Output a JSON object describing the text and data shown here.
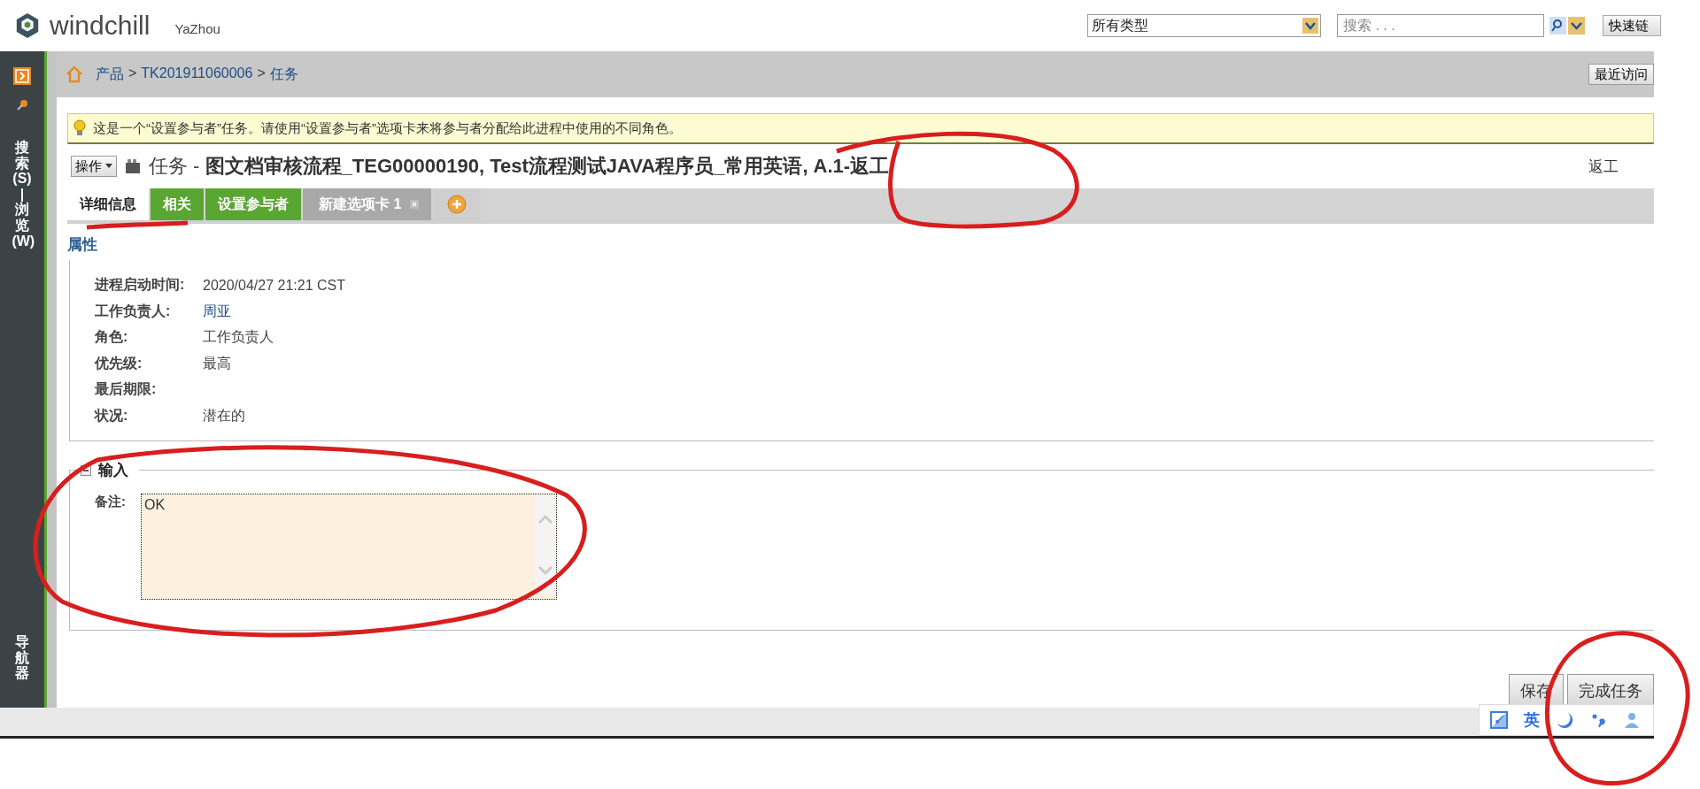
{
  "header": {
    "logo": "windchill",
    "user": "YaZhou",
    "type_select": {
      "value": "所有类型"
    },
    "search": {
      "placeholder": "搜索 . . ."
    },
    "quick_links": "快速链"
  },
  "sidebar": {
    "tabs": [
      {
        "label": "搜索(S) | 浏览(W)"
      },
      {
        "label": "导航器"
      }
    ]
  },
  "breadcrumb": {
    "separator": ">",
    "items": [
      "产品",
      "TK201911060006",
      "任务"
    ],
    "recent": "最近访问"
  },
  "tip": "这是一个“设置参与者”任务。请使用“设置参与者”选项卡来将参与者分配给此进程中使用的不同角色。",
  "title": {
    "actions": "操作",
    "text": "任务 - **图文档审核流程_TEG00000190, Test流程测试JAVA程序员_常用英语, A.1-返工**",
    "state": "返工"
  },
  "tabs": [
    {
      "label": "详细信息",
      "kind": "plain",
      "selected": true
    },
    {
      "label": "相关",
      "kind": "green",
      "selected": false
    },
    {
      "label": "设置参与者",
      "kind": "green",
      "selected": false
    },
    {
      "label": "新建选项卡 1",
      "kind": "closable",
      "selected": false
    },
    {
      "kind": "add",
      "selected": false
    }
  ],
  "attributes": {
    "heading": "属性",
    "rows": [
      {
        "label": "进程启动时间:",
        "value": "2020/04/27 21:21 CST",
        "kind": "text"
      },
      {
        "label": "工作负责人:",
        "value": "周亚",
        "kind": "link"
      },
      {
        "label": "角色:",
        "value": "工作负责人",
        "kind": "text"
      },
      {
        "label": "优先级:",
        "value": "最高",
        "kind": "text"
      },
      {
        "label": "最后期限:"
      },
      {
        "label": "状况:",
        "value": "潜在的",
        "kind": "text"
      }
    ]
  },
  "input": {
    "heading": "输入",
    "expanded": true,
    "fields": [
      {
        "label": "备注:",
        "value": "OK"
      }
    ]
  },
  "buttons": [
    "保存",
    "完成任务"
  ],
  "ime_toolbar": {
    "label": "英"
  }
}
